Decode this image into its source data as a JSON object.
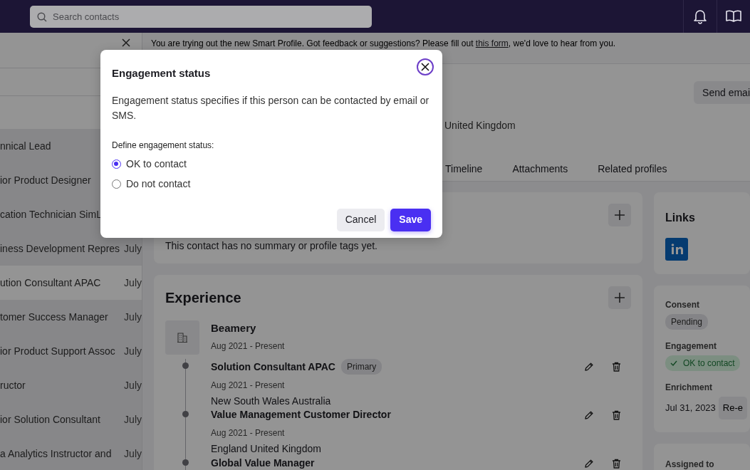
{
  "top_bar": {
    "search": {
      "placeholder": "Search contacts"
    }
  },
  "contact_list": {
    "rows": [
      {
        "title": "nnical Lead",
        "selected": false
      },
      {
        "title": "ior Product Designer",
        "selected": false
      },
      {
        "title": "cation Technician SimL",
        "selected": false
      },
      {
        "title": "iness Development Repres",
        "date": "July",
        "selected": false
      },
      {
        "title": "ution Consultant APAC",
        "date": "July",
        "selected": true
      },
      {
        "title": "tomer Success Manager",
        "date": "July",
        "selected": false
      },
      {
        "title": "ior Product Support Assoc",
        "date": "July",
        "selected": false
      },
      {
        "title": "ructor",
        "date": "July",
        "selected": false
      },
      {
        "title": "ior Solution Consultant",
        "date": "July",
        "selected": false
      },
      {
        "title": "a Analytics Instructor and",
        "date": "July",
        "selected": false
      }
    ]
  },
  "banner": {
    "text": "You are trying out the new Smart Profile. Got feedback or suggestions? Please fill out ",
    "link": "this form",
    "after": ", we'd love to hear from you."
  },
  "header": {
    "send_button": "Send emai",
    "location": "United Kingdom"
  },
  "tabs": [
    {
      "label": "Timeline",
      "selected": false
    },
    {
      "label": "Attachments",
      "selected": false
    },
    {
      "label": "Related profiles",
      "selected": false
    }
  ],
  "summary": {
    "text": "This contact has no summary or profile tags yet."
  },
  "experience": {
    "title": "Experience",
    "companies": [
      {
        "name": "Beamery",
        "dates": "Aug 2021 - Present",
        "roles": [
          {
            "title": "Solution Consultant APAC",
            "badge": "Primary",
            "dates": "Aug 2021 - Present",
            "location": "New South Wales Australia"
          },
          {
            "title": "Value Management Customer Director",
            "dates": "Aug 2021 - Present",
            "location": "England United Kingdom"
          },
          {
            "title": "Global Value Manager"
          }
        ]
      }
    ]
  },
  "links": {
    "title": "Links"
  },
  "status": {
    "fields": [
      {
        "label": "Consent",
        "kind": "badge",
        "value": "Pending"
      },
      {
        "label": "Engagement",
        "kind": "success",
        "value": "OK to contact"
      },
      {
        "label": "Enrichment",
        "kind": "date",
        "value": "Jul 31, 2023",
        "button": "Re-e"
      }
    ]
  },
  "assigned": {
    "label": "Assigned to"
  },
  "dialog": {
    "title": "Engagement status",
    "description": "Engagement status specifies if this person can be contacted by email or SMS.",
    "group_label": "Define engagement status:",
    "options": [
      {
        "label": "OK to contact",
        "selected": true
      },
      {
        "label": "Do not contact",
        "selected": false
      }
    ],
    "buttons": [
      {
        "label": "Cancel",
        "kind": "secondary"
      },
      {
        "label": "Save",
        "kind": "primary"
      }
    ]
  }
}
